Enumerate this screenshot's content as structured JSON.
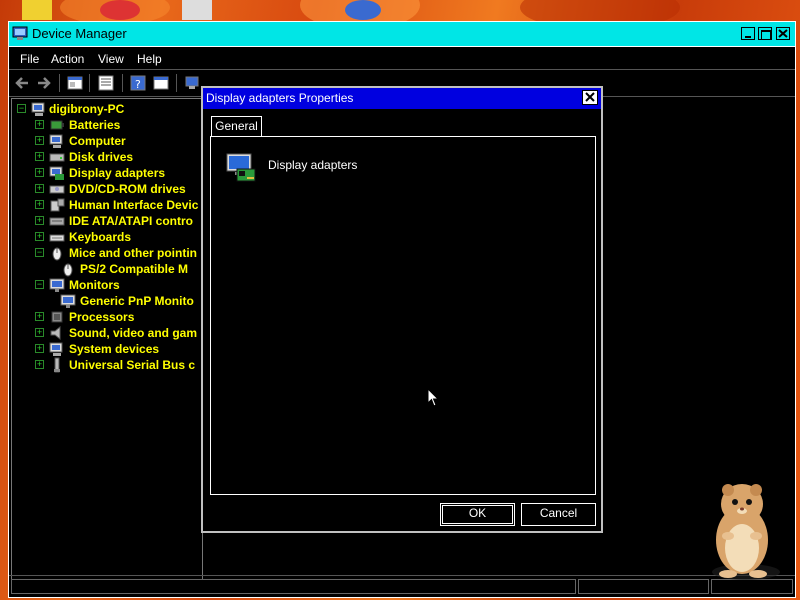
{
  "window": {
    "title": "Device Manager",
    "menu": [
      "File",
      "Action",
      "View",
      "Help"
    ],
    "controls": [
      "minimize",
      "maximize",
      "close"
    ]
  },
  "tree": {
    "root": "digibrony-PC",
    "items": [
      {
        "label": "Batteries",
        "icon": "battery-icon",
        "expanded": false
      },
      {
        "label": "Computer",
        "icon": "computer-icon",
        "expanded": false
      },
      {
        "label": "Disk drives",
        "icon": "disk-drive-icon",
        "expanded": false
      },
      {
        "label": "Display adapters",
        "icon": "display-adapter-icon",
        "expanded": false
      },
      {
        "label": "DVD/CD-ROM drives",
        "icon": "dvd-drive-icon",
        "expanded": false
      },
      {
        "label": "Human Interface Devic",
        "icon": "hid-icon",
        "expanded": false
      },
      {
        "label": "IDE ATA/ATAPI contro",
        "icon": "ide-icon",
        "expanded": false
      },
      {
        "label": "Keyboards",
        "icon": "keyboard-icon",
        "expanded": false
      },
      {
        "label": "Mice and other pointin",
        "icon": "mouse-icon",
        "expanded": true
      },
      {
        "label": "PS/2 Compatible M",
        "icon": "mouse-icon",
        "child": true
      },
      {
        "label": "Monitors",
        "icon": "monitor-icon",
        "expanded": true
      },
      {
        "label": "Generic PnP Monito",
        "icon": "monitor-icon",
        "child": true
      },
      {
        "label": "Processors",
        "icon": "processor-icon",
        "expanded": false
      },
      {
        "label": "Sound, video and gam",
        "icon": "speaker-icon",
        "expanded": false
      },
      {
        "label": "System devices",
        "icon": "system-device-icon",
        "expanded": false
      },
      {
        "label": "Universal Serial Bus c",
        "icon": "usb-icon",
        "expanded": false
      }
    ]
  },
  "dialog": {
    "title": "Display adapters Properties",
    "tab": "General",
    "device_label": "Display adapters",
    "ok_label": "OK",
    "cancel_label": "Cancel"
  },
  "colors": {
    "window_title_bg": "#00e6e6",
    "dialog_title_bg": "#0000e0",
    "tree_text": "#ffff00",
    "background": "#000000"
  }
}
